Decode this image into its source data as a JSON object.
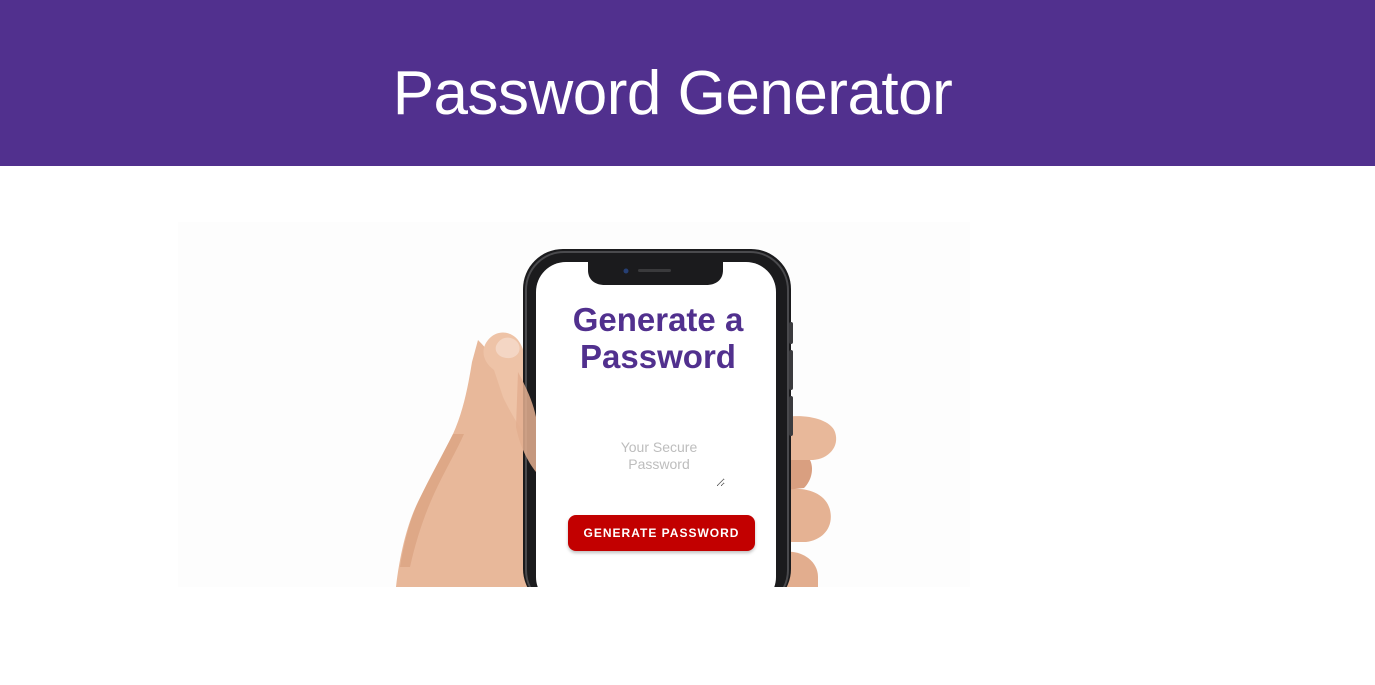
{
  "header": {
    "title": "Password Generator"
  },
  "card": {
    "heading": "Generate a Password",
    "password_placeholder": "Your Secure Password",
    "password_value": "",
    "generate_label": "GENERATE PASSWORD"
  },
  "colors": {
    "brand_purple": "#51308e",
    "button_red": "#c20000",
    "placeholder_gray": "#bdbdbd"
  },
  "icons": {
    "resize_handle": "resize-handle-icon"
  }
}
